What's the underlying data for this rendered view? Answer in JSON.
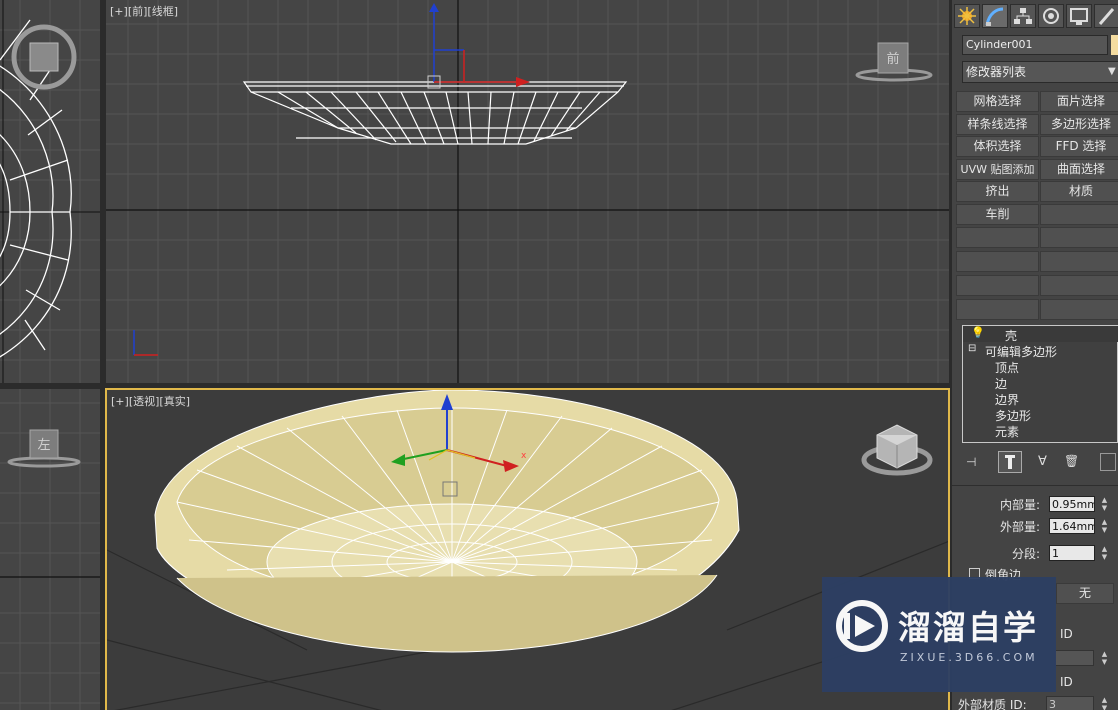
{
  "viewports": {
    "top_left": {},
    "front": {
      "label_plus": "[+]",
      "label_view": "[前]",
      "label_mode": "[线框]",
      "viewcube": "前"
    },
    "left": {
      "viewcube": "左"
    },
    "perspective": {
      "label_plus": "[+]",
      "label_view": "[透视]",
      "label_mode": "[真实]"
    }
  },
  "panel": {
    "tabs": [
      "create-icon",
      "modify-icon",
      "hierarchy-icon",
      "motion-icon",
      "display-icon",
      "utilities-icon"
    ],
    "object_name": "Cylinder001",
    "object_color": "#f4dca0",
    "modifier_list": "修改器列表",
    "modifier_buttons": [
      "网格选择",
      "面片选择",
      "样条线选择",
      "多边形选择",
      "体积选择",
      "FFD 选择",
      "UVW 贴图添加",
      "曲面选择",
      "挤出",
      "材质",
      "车削"
    ],
    "stack": {
      "top": "壳",
      "base": "可编辑多边形",
      "subs": [
        "顶点",
        "边",
        "边界",
        "多边形",
        "元素"
      ]
    },
    "params": {
      "inner_label": "内部量:",
      "inner_value": "0.95mm",
      "outer_label": "外部量:",
      "outer_value": "1.64mm",
      "segments_label": "分段:",
      "segments_value": "1",
      "bevel_label": "倒角边",
      "none_button": "无",
      "id_label_1": "ID",
      "id_label_2": "ID",
      "outer_mat_label": "外部材质 ID:",
      "outer_mat_value": "3"
    }
  },
  "watermark": {
    "title": "溜溜自学",
    "url": "ZIXUE.3D66.COM"
  },
  "colors": {
    "viewport_bg": "#454545",
    "active_border": "#e0b84a",
    "bowl_fill": "#e6dba6",
    "axis_x": "#d02020",
    "axis_y": "#20a020",
    "axis_z": "#2040d0"
  }
}
